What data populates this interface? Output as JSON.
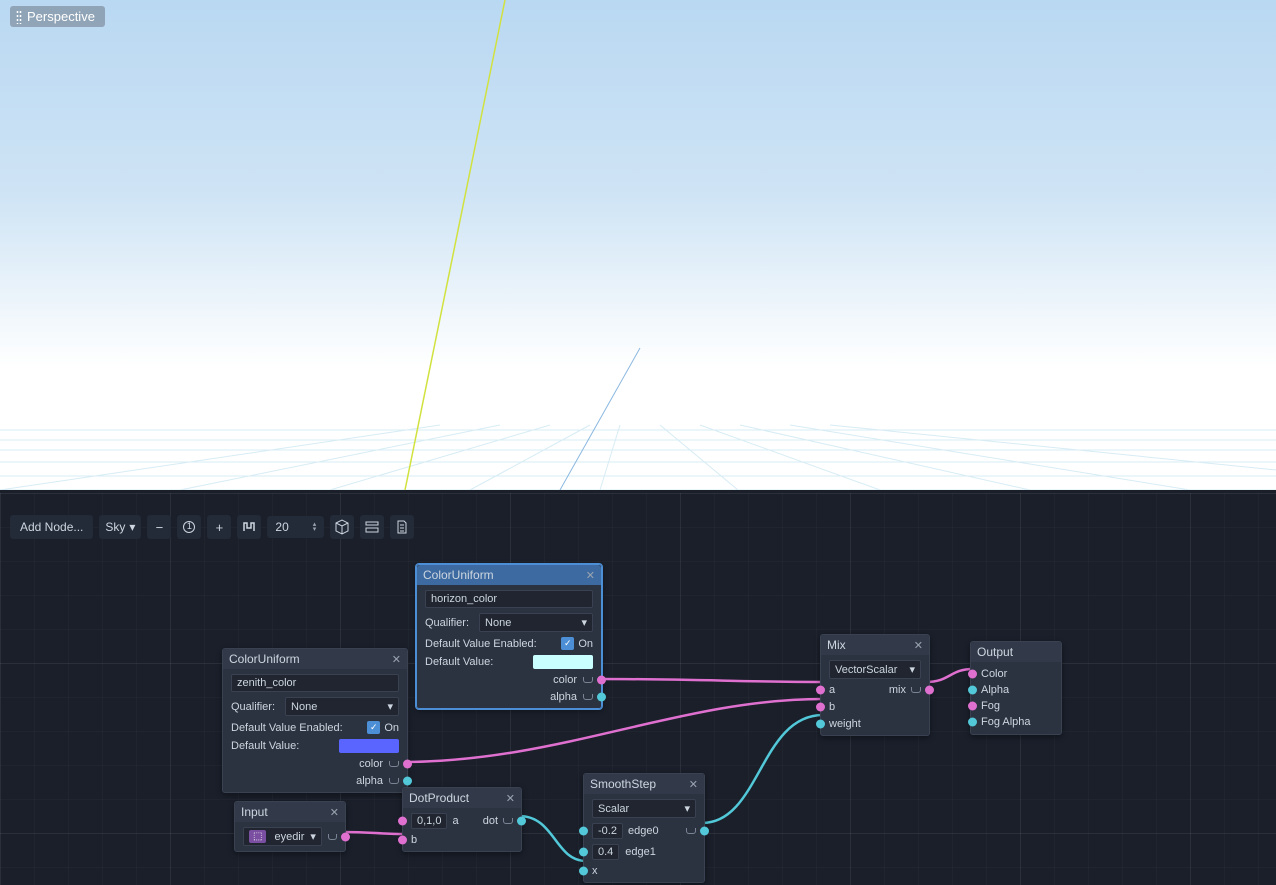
{
  "viewport": {
    "mode_label": "Perspective",
    "sky_gradient": {
      "top": "#b9d8f2",
      "bottom": "#ffffff"
    },
    "axis_colors": {
      "y": "#d7e84a",
      "z": "#4d8fd6"
    }
  },
  "toolbar": {
    "add_node_label": "Add Node...",
    "shader_type": "Sky",
    "zoom_value": "20"
  },
  "nodes": {
    "color_uniform_zenith": {
      "title": "ColorUniform",
      "name_field": "zenith_color",
      "qualifier_label": "Qualifier:",
      "qualifier_value": "None",
      "default_enabled_label": "Default Value Enabled:",
      "default_enabled_state": "On",
      "default_value_label": "Default Value:",
      "default_swatch": "#5a65ff",
      "out_color": "color",
      "out_alpha": "alpha"
    },
    "color_uniform_horizon": {
      "title": "ColorUniform",
      "name_field": "horizon_color",
      "qualifier_label": "Qualifier:",
      "qualifier_value": "None",
      "default_enabled_label": "Default Value Enabled:",
      "default_enabled_state": "On",
      "default_value_label": "Default Value:",
      "default_swatch": "#caffff",
      "out_color": "color",
      "out_alpha": "alpha"
    },
    "input": {
      "title": "Input",
      "value": "eyedir"
    },
    "dot_product": {
      "title": "DotProduct",
      "a_const": "0,1,0",
      "a_label": "a",
      "b_label": "b",
      "out_label": "dot"
    },
    "smooth_step": {
      "title": "SmoothStep",
      "type": "Scalar",
      "edge0_val": "-0.2",
      "edge0_label": "edge0",
      "edge1_val": "0.4",
      "edge1_label": "edge1",
      "x_label": "x"
    },
    "mix": {
      "title": "Mix",
      "type": "VectorScalar",
      "a_label": "a",
      "b_label": "b",
      "weight_label": "weight",
      "out_label": "mix"
    },
    "output": {
      "title": "Output",
      "ports": {
        "color": "Color",
        "alpha": "Alpha",
        "fog": "Fog",
        "fog_alpha": "Fog Alpha"
      }
    }
  }
}
